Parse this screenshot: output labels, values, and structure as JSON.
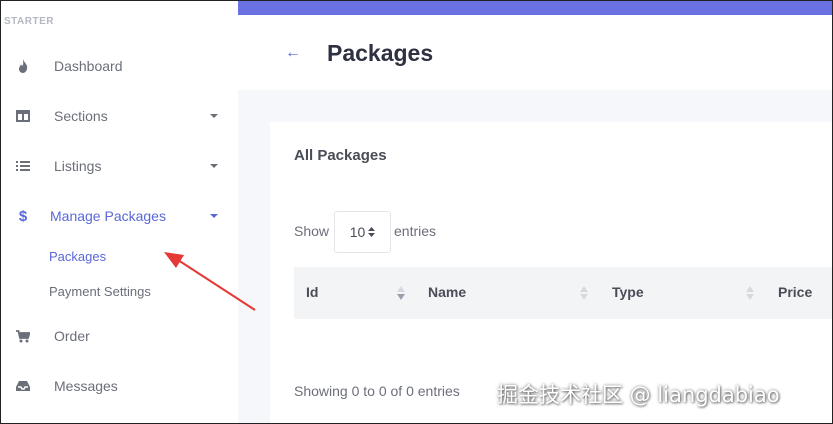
{
  "sidebar": {
    "brand": "STARTER",
    "items": [
      {
        "label": "Dashboard",
        "icon": "flame-icon"
      },
      {
        "label": "Sections",
        "icon": "columns-icon"
      },
      {
        "label": "Listings",
        "icon": "list-icon"
      },
      {
        "label": "Manage Packages",
        "icon": "dollar-icon"
      },
      {
        "label": "Order",
        "icon": "cart-icon"
      },
      {
        "label": "Messages",
        "icon": "inbox-icon"
      }
    ],
    "sub_items": [
      {
        "label": "Packages"
      },
      {
        "label": "Payment Settings"
      }
    ],
    "dollar_glyph": "$"
  },
  "header": {
    "back_glyph": "←",
    "title": "Packages"
  },
  "card": {
    "title": "All Packages",
    "show_label": "Show",
    "entries_value": "10",
    "entries_label": "entries",
    "columns": [
      "Id",
      "Name",
      "Type",
      "Price"
    ],
    "info": "Showing 0 to 0 of 0 entries"
  },
  "watermark": "掘金技术社区 @ liangdabiao",
  "colors": {
    "accent": "#5a67d8",
    "topbar": "#6a71e2",
    "annotation": "#e53935"
  }
}
